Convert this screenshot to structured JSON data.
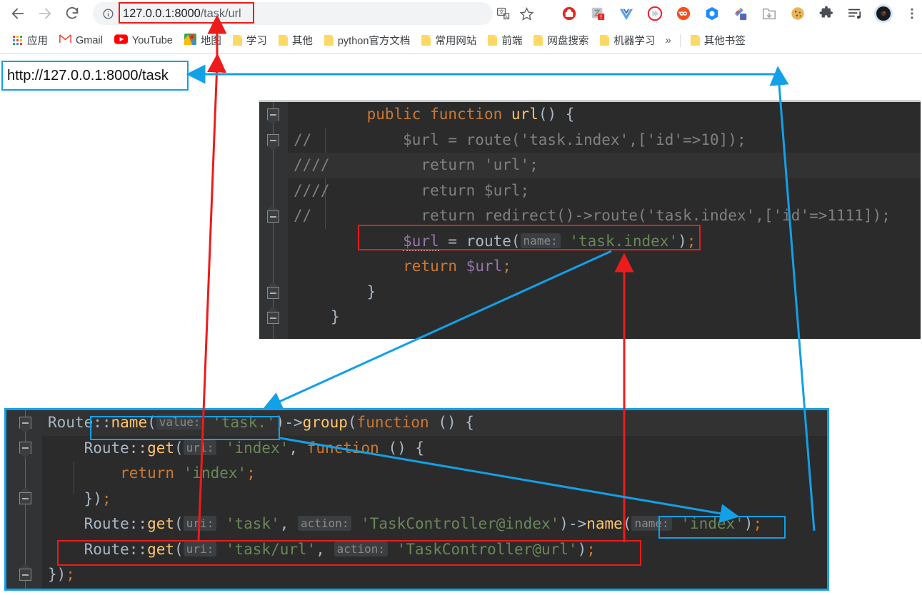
{
  "browser": {
    "nav": {
      "back_label": "Back",
      "forward_label": "Forward",
      "reload_label": "Reload"
    },
    "omnibox": {
      "info_icon": "info-circle-icon",
      "url_host": "127.0.0.1:8000",
      "url_path": "/task/url",
      "full_url": "127.0.0.1:8000/task/url",
      "translate_icon": "translate-icon",
      "bookmark_icon": "star-icon"
    },
    "extensions": [
      {
        "name": "adblock-icon",
        "color": "#e8271e"
      },
      {
        "name": "grammar-checker-icon",
        "color": "#9aa0a6"
      },
      {
        "name": "vue-devtools-icon",
        "color": "#41b883"
      },
      {
        "name": "video-speed-icon",
        "color": "#ec2028"
      },
      {
        "name": "infinity-new-tab-icon",
        "color": "#f4511e"
      },
      {
        "name": "octotree-icon",
        "color": "#1a8cff"
      },
      {
        "name": "screenshot-icon",
        "color": "#4a6fd4"
      },
      {
        "name": "download-icon",
        "color": "#9aa0a6"
      },
      {
        "name": "cookie-editor-icon",
        "color": "#d9a441"
      },
      {
        "name": "extensions-puzzle-icon",
        "color": "#5f6368"
      },
      {
        "name": "reading-list-icon",
        "color": "#3c4043"
      },
      {
        "name": "profile-avatar-icon",
        "color": "#1a1a1a"
      },
      {
        "name": "chrome-menu-icon",
        "color": "#5f6368"
      }
    ],
    "bookmarks": [
      {
        "label": "应用",
        "icon": "apps-grid-icon"
      },
      {
        "label": "Gmail",
        "icon": "gmail-icon"
      },
      {
        "label": "YouTube",
        "icon": "youtube-icon"
      },
      {
        "label": "地图",
        "icon": "google-maps-icon"
      },
      {
        "label": "学习",
        "icon": "folder-icon"
      },
      {
        "label": "其他",
        "icon": "folder-icon"
      },
      {
        "label": "python官方文档",
        "icon": "folder-icon"
      },
      {
        "label": "常用网站",
        "icon": "folder-icon"
      },
      {
        "label": "前端",
        "icon": "folder-icon"
      },
      {
        "label": "网盘搜索",
        "icon": "folder-icon"
      },
      {
        "label": "机器学习",
        "icon": "folder-icon"
      }
    ],
    "bookmarks_overflow_label": "»",
    "other_bookmarks": {
      "label": "其他书签",
      "icon": "folder-icon"
    }
  },
  "annotation_url_box": {
    "text": "http://127.0.0.1:8000/task"
  },
  "code_top": {
    "lines": [
      {
        "comment": "",
        "tokens": [
          {
            "t": "    ",
            "c": "punc"
          },
          {
            "t": "public",
            "c": "kw"
          },
          {
            "t": " ",
            "c": "punc"
          },
          {
            "t": "function",
            "c": "kw"
          },
          {
            "t": " ",
            "c": "punc"
          },
          {
            "t": "url",
            "c": "fn"
          },
          {
            "t": "() {",
            "c": "punc"
          }
        ]
      },
      {
        "comment": "//",
        "tokens": [
          {
            "t": "        $url = route('task.index',['id'=>10]);",
            "c": "comment"
          }
        ]
      },
      {
        "comment": "////",
        "highlight": true,
        "tokens": [
          {
            "t": "          return 'url';",
            "c": "comment"
          }
        ]
      },
      {
        "comment": "////",
        "tokens": [
          {
            "t": "          return $url;",
            "c": "comment"
          }
        ]
      },
      {
        "comment": "//",
        "tokens": [
          {
            "t": "          return redirect()->route('task.index',['id'=>1111]);",
            "c": "comment"
          }
        ]
      },
      {
        "comment": "",
        "tokens": [
          {
            "t": "        ",
            "c": "punc"
          },
          {
            "t": "$url",
            "c": "var",
            "squiggle": true
          },
          {
            "t": " = ",
            "c": "punc"
          },
          {
            "t": "route",
            "c": "punc"
          },
          {
            "t": "(",
            "c": "punc"
          },
          {
            "t": "name:",
            "c": "hint"
          },
          {
            "t": " ",
            "c": "punc"
          },
          {
            "t": "'task.index'",
            "c": "str"
          },
          {
            "t": ")",
            "c": "punc"
          },
          {
            "t": ";",
            "c": "kw"
          }
        ]
      },
      {
        "comment": "",
        "tokens": [
          {
            "t": "        ",
            "c": "punc"
          },
          {
            "t": "return",
            "c": "kw"
          },
          {
            "t": " ",
            "c": "punc"
          },
          {
            "t": "$url",
            "c": "var"
          },
          {
            "t": ";",
            "c": "kw"
          }
        ]
      },
      {
        "comment": "",
        "tokens": [
          {
            "t": "    }",
            "c": "brc"
          }
        ]
      },
      {
        "comment": "",
        "tokens": [
          {
            "t": "}",
            "c": "brc"
          }
        ]
      }
    ]
  },
  "code_bottom": {
    "lines": [
      {
        "current": true,
        "tokens": [
          {
            "t": "Route::",
            "c": "punc"
          },
          {
            "t": "name",
            "c": "fn"
          },
          {
            "t": "(",
            "c": "punc"
          },
          {
            "t": "value:",
            "c": "hint"
          },
          {
            "t": " ",
            "c": "punc"
          },
          {
            "t": "'task.'",
            "c": "str"
          },
          {
            "t": ")",
            "c": "punc"
          },
          {
            "t": "->",
            "c": "punc"
          },
          {
            "t": "group",
            "c": "fn"
          },
          {
            "t": "(",
            "c": "punc"
          },
          {
            "t": "function",
            "c": "kw"
          },
          {
            "t": " () {",
            "c": "punc"
          }
        ]
      },
      {
        "tokens": [
          {
            "t": "    Route::",
            "c": "punc"
          },
          {
            "t": "get",
            "c": "fn"
          },
          {
            "t": "(",
            "c": "punc"
          },
          {
            "t": "uri:",
            "c": "hint"
          },
          {
            "t": " ",
            "c": "punc"
          },
          {
            "t": "'index'",
            "c": "str"
          },
          {
            "t": ", ",
            "c": "punc"
          },
          {
            "t": "function",
            "c": "kw"
          },
          {
            "t": " () {",
            "c": "punc"
          }
        ]
      },
      {
        "tokens": [
          {
            "t": "        ",
            "c": "punc"
          },
          {
            "t": "return",
            "c": "kw"
          },
          {
            "t": " ",
            "c": "punc"
          },
          {
            "t": "'index'",
            "c": "str"
          },
          {
            "t": ";",
            "c": "kw"
          }
        ]
      },
      {
        "tokens": [
          {
            "t": "    })",
            "c": "punc"
          },
          {
            "t": ";",
            "c": "kw"
          }
        ]
      },
      {
        "tokens": [
          {
            "t": "    Route::",
            "c": "punc"
          },
          {
            "t": "get",
            "c": "fn"
          },
          {
            "t": "(",
            "c": "punc"
          },
          {
            "t": "uri:",
            "c": "hint"
          },
          {
            "t": " ",
            "c": "punc"
          },
          {
            "t": "'task'",
            "c": "str"
          },
          {
            "t": ", ",
            "c": "punc"
          },
          {
            "t": "action:",
            "c": "hint"
          },
          {
            "t": " ",
            "c": "punc"
          },
          {
            "t": "'TaskController@index'",
            "c": "str"
          },
          {
            "t": ")",
            "c": "punc"
          },
          {
            "t": "->",
            "c": "punc"
          },
          {
            "t": "name",
            "c": "fn"
          },
          {
            "t": "(",
            "c": "punc"
          },
          {
            "t": "name:",
            "c": "hint"
          },
          {
            "t": " ",
            "c": "punc"
          },
          {
            "t": "'index'",
            "c": "str"
          },
          {
            "t": ")",
            "c": "punc"
          },
          {
            "t": ";",
            "c": "kw"
          }
        ]
      },
      {
        "tokens": [
          {
            "t": "    Route::",
            "c": "punc"
          },
          {
            "t": "get",
            "c": "fn"
          },
          {
            "t": "(",
            "c": "punc"
          },
          {
            "t": "uri:",
            "c": "hint"
          },
          {
            "t": " ",
            "c": "punc"
          },
          {
            "t": "'task/url'",
            "c": "str"
          },
          {
            "t": ", ",
            "c": "punc"
          },
          {
            "t": "action:",
            "c": "hint"
          },
          {
            "t": " ",
            "c": "punc"
          },
          {
            "t": "'TaskController@url'",
            "c": "str"
          },
          {
            "t": ")",
            "c": "punc"
          },
          {
            "t": ";",
            "c": "kw"
          }
        ]
      },
      {
        "tokens": [
          {
            "t": "})",
            "c": "punc"
          },
          {
            "t": ";",
            "c": "kw"
          }
        ]
      }
    ]
  },
  "annotations": {
    "red_color": "#ee1b1b",
    "blue_color": "#12a0e8",
    "boxes": [
      {
        "name": "url-bar-red-box",
        "color": "#ee1b1b"
      },
      {
        "name": "route-call-red-box",
        "color": "#ee1b1b"
      },
      {
        "name": "task-url-route-red-box",
        "color": "#ee1b1b"
      },
      {
        "name": "route-name-blue-box",
        "color": "#12a0e8"
      },
      {
        "name": "name-index-blue-box",
        "color": "#12a0e8"
      },
      {
        "name": "generated-url-blue-box",
        "color": "#12a0e8"
      }
    ]
  }
}
